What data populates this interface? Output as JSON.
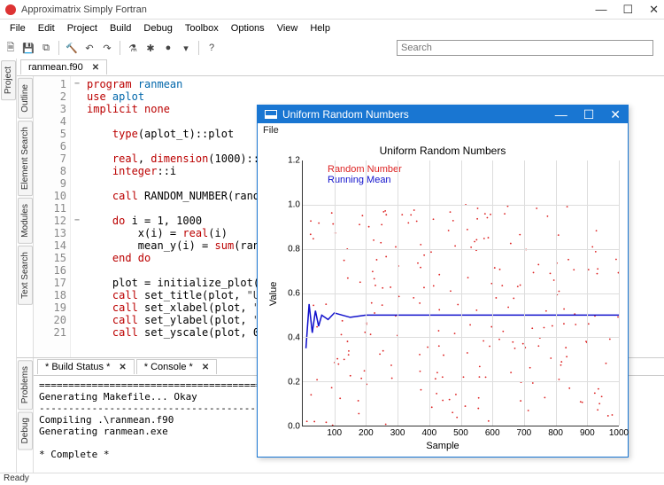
{
  "window": {
    "title": "Approximatrix Simply Fortran",
    "min": "—",
    "max": "☐",
    "close": "✕"
  },
  "menubar": [
    "File",
    "Edit",
    "Project",
    "Build",
    "Debug",
    "Toolbox",
    "Options",
    "View",
    "Help"
  ],
  "search_placeholder": "Search",
  "side_left": [
    "Project",
    "Outline",
    "Element Search",
    "Modules",
    "Text Search"
  ],
  "side_bottom": [
    "Problems",
    "Debug"
  ],
  "editor_tab": {
    "name": "ranmean.f90",
    "x": "✕"
  },
  "code_lines": [
    {
      "n": 1,
      "fold": "−",
      "html": "<span class='kw'>program</span> <span class='id'>ranmean</span>"
    },
    {
      "n": 2,
      "fold": "",
      "html": "<span class='kw'>use</span> <span class='id'>aplot</span>"
    },
    {
      "n": 3,
      "fold": "",
      "html": "<span class='kw'>implicit none</span>"
    },
    {
      "n": 4,
      "fold": "",
      "html": ""
    },
    {
      "n": 5,
      "fold": "",
      "html": "    <span class='kw'>type</span>(aplot_t)::plot"
    },
    {
      "n": 6,
      "fold": "",
      "html": ""
    },
    {
      "n": 7,
      "fold": "",
      "html": "    <span class='kw'>real</span>, <span class='kw'>dimension</span>(1000)::x,"
    },
    {
      "n": 8,
      "fold": "",
      "html": "    <span class='kw'>integer</span>::i"
    },
    {
      "n": 9,
      "fold": "",
      "html": ""
    },
    {
      "n": 10,
      "fold": "",
      "html": "    <span class='kw'>call</span> RANDOM_NUMBER(rand_y"
    },
    {
      "n": 11,
      "fold": "",
      "html": ""
    },
    {
      "n": 12,
      "fold": "−",
      "html": "    <span class='kw'>do</span> i = 1, 1000"
    },
    {
      "n": 13,
      "fold": "",
      "html": "        x(i) = <span class='kw'>real</span>(i)"
    },
    {
      "n": 14,
      "fold": "",
      "html": "        mean_y(i) = <span class='kw'>sum</span>(rand_"
    },
    {
      "n": 15,
      "fold": "",
      "html": "    <span class='kw'>end do</span>"
    },
    {
      "n": 16,
      "fold": "",
      "html": ""
    },
    {
      "n": 17,
      "fold": "",
      "html": "    plot = initialize_plot()"
    },
    {
      "n": 18,
      "fold": "",
      "html": "    <span class='kw'>call</span> set_title(plot, <span class='str'>\"Uni</span>"
    },
    {
      "n": 19,
      "fold": "",
      "html": "    <span class='kw'>call</span> set_xlabel(plot, <span class='str'>\"Sa</span>"
    },
    {
      "n": 20,
      "fold": "",
      "html": "    <span class='kw'>call</span> set_ylabel(plot, <span class='str'>\"Va</span>"
    },
    {
      "n": 21,
      "fold": "",
      "html": "    <span class='kw'>call</span> set_yscale(plot, 0.0"
    }
  ],
  "bottom_tabs": [
    {
      "label": "* Build Status *",
      "x": "✕"
    },
    {
      "label": "* Console *",
      "x": "✕"
    }
  ],
  "build_output": "========================================\nGenerating Makefile... Okay\n----------------------------------------\nCompiling .\\ranmean.f90\nGenerating ranmean.exe\n\n* Complete *",
  "status": "Ready",
  "plot": {
    "win_title": "Uniform Random Numbers",
    "menu": "File",
    "title": "Uniform Random Numbers",
    "xlabel": "Sample",
    "ylabel": "Value",
    "legend1": "Random Number",
    "legend2": "Running Mean",
    "yticks": [
      "0.0",
      "0.2",
      "0.4",
      "0.6",
      "0.8",
      "1.0",
      "1.2"
    ],
    "xticks": [
      "100",
      "200",
      "300",
      "400",
      "500",
      "600",
      "700",
      "800",
      "900",
      "1000"
    ]
  },
  "chart_data": {
    "type": "scatter",
    "title": "Uniform Random Numbers",
    "xlabel": "Sample",
    "ylabel": "Value",
    "xlim": [
      0,
      1000
    ],
    "ylim": [
      0.0,
      1.2
    ],
    "series": [
      {
        "name": "Random Number",
        "type": "scatter",
        "color": "#d22",
        "note": "1000 uniform random samples in [0,1]"
      },
      {
        "name": "Running Mean",
        "type": "line",
        "color": "#11c",
        "x": [
          10,
          20,
          30,
          40,
          50,
          60,
          80,
          100,
          150,
          200,
          300,
          400,
          500,
          600,
          700,
          800,
          900,
          1000
        ],
        "y": [
          0.35,
          0.55,
          0.42,
          0.52,
          0.45,
          0.5,
          0.48,
          0.51,
          0.49,
          0.5,
          0.5,
          0.5,
          0.5,
          0.5,
          0.5,
          0.5,
          0.5,
          0.5
        ]
      }
    ]
  }
}
